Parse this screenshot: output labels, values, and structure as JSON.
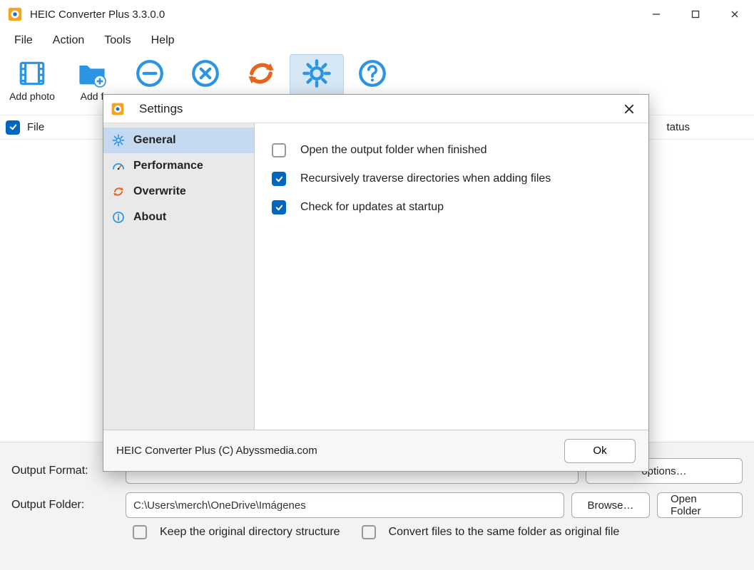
{
  "window": {
    "title": "HEIC Converter Plus 3.3.0.0"
  },
  "menubar": [
    "File",
    "Action",
    "Tools",
    "Help"
  ],
  "toolbar": [
    {
      "label": "Add photo",
      "icon": "film-icon",
      "color": "blue"
    },
    {
      "label": "Add f",
      "icon": "folder-plus-icon",
      "color": "blue"
    },
    {
      "label": "",
      "icon": "minus-circle-icon",
      "color": "blue"
    },
    {
      "label": "",
      "icon": "x-circle-icon",
      "color": "blue"
    },
    {
      "label": "",
      "icon": "refresh-icon",
      "color": "orange"
    },
    {
      "label": "",
      "icon": "gear-icon",
      "color": "blue",
      "active": true
    },
    {
      "label": "",
      "icon": "question-circle-icon",
      "color": "blue"
    }
  ],
  "filelist": {
    "header_file": "File",
    "header_status": "tatus"
  },
  "bottom": {
    "output_format_label": "Output Format:",
    "options_btn": "options…",
    "output_folder_label": "Output Folder:",
    "output_folder_value": "C:\\Users\\merch\\OneDrive\\Imágenes",
    "browse_btn": "Browse…",
    "open_folder_btn": "Open Folder",
    "keep_structure": "Keep the original directory structure",
    "same_folder": "Convert files to the same folder as original file"
  },
  "settings": {
    "title": "Settings",
    "tabs": [
      {
        "label": "General",
        "icon": "gear-icon",
        "selected": true
      },
      {
        "label": "Performance",
        "icon": "gauge-icon",
        "selected": false
      },
      {
        "label": "Overwrite",
        "icon": "refresh-icon-orange",
        "selected": false
      },
      {
        "label": "About",
        "icon": "info-circle-icon",
        "selected": false
      }
    ],
    "options": [
      {
        "label": "Open the output folder when finished",
        "checked": false
      },
      {
        "label": "Recursively traverse directories when adding files",
        "checked": true
      },
      {
        "label": "Check for updates at startup",
        "checked": true
      }
    ],
    "footer_text": "HEIC Converter Plus (C) Abyssmedia.com",
    "ok_btn": "Ok"
  }
}
